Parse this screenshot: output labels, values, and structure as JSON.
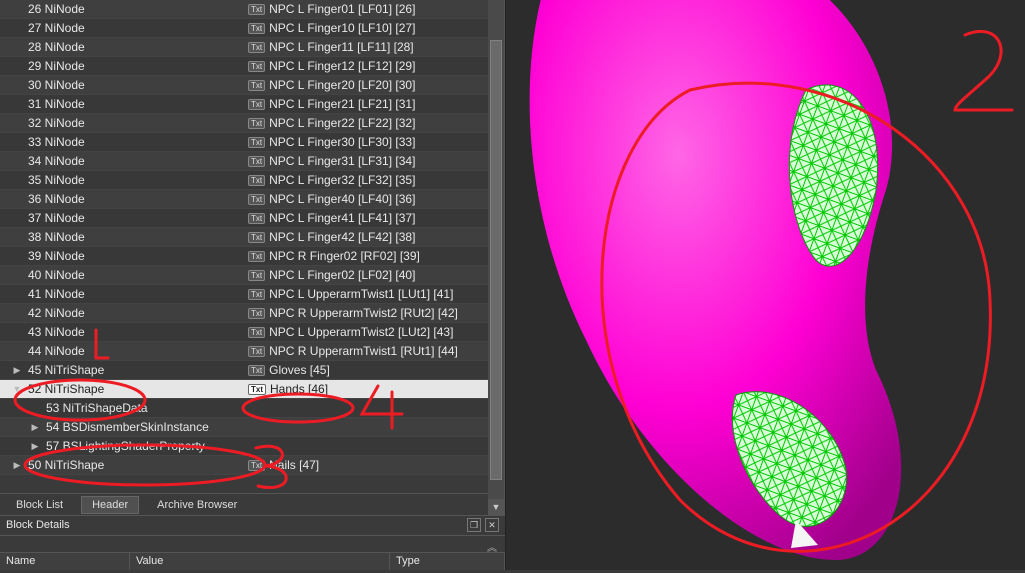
{
  "tree": [
    {
      "id": 26,
      "type": "NiNode",
      "value": "NPC L Finger01 [LF01] [26]",
      "indent": 0,
      "stripe": "even"
    },
    {
      "id": 27,
      "type": "NiNode",
      "value": "NPC L Finger10 [LF10] [27]",
      "indent": 0,
      "stripe": "odd"
    },
    {
      "id": 28,
      "type": "NiNode",
      "value": "NPC L Finger11 [LF11] [28]",
      "indent": 0,
      "stripe": "even"
    },
    {
      "id": 29,
      "type": "NiNode",
      "value": "NPC L Finger12 [LF12] [29]",
      "indent": 0,
      "stripe": "odd"
    },
    {
      "id": 30,
      "type": "NiNode",
      "value": "NPC L Finger20 [LF20] [30]",
      "indent": 0,
      "stripe": "even"
    },
    {
      "id": 31,
      "type": "NiNode",
      "value": "NPC L Finger21 [LF21] [31]",
      "indent": 0,
      "stripe": "odd"
    },
    {
      "id": 32,
      "type": "NiNode",
      "value": "NPC L Finger22 [LF22] [32]",
      "indent": 0,
      "stripe": "even"
    },
    {
      "id": 33,
      "type": "NiNode",
      "value": "NPC L Finger30 [LF30] [33]",
      "indent": 0,
      "stripe": "odd"
    },
    {
      "id": 34,
      "type": "NiNode",
      "value": "NPC L Finger31 [LF31] [34]",
      "indent": 0,
      "stripe": "even"
    },
    {
      "id": 35,
      "type": "NiNode",
      "value": "NPC L Finger32 [LF32] [35]",
      "indent": 0,
      "stripe": "odd"
    },
    {
      "id": 36,
      "type": "NiNode",
      "value": "NPC L Finger40 [LF40] [36]",
      "indent": 0,
      "stripe": "even"
    },
    {
      "id": 37,
      "type": "NiNode",
      "value": "NPC L Finger41 [LF41] [37]",
      "indent": 0,
      "stripe": "odd"
    },
    {
      "id": 38,
      "type": "NiNode",
      "value": "NPC L Finger42 [LF42] [38]",
      "indent": 0,
      "stripe": "even"
    },
    {
      "id": 39,
      "type": "NiNode",
      "value": "NPC R Finger02 [RF02] [39]",
      "indent": 0,
      "stripe": "odd"
    },
    {
      "id": 40,
      "type": "NiNode",
      "value": "NPC L Finger02 [LF02] [40]",
      "indent": 0,
      "stripe": "even"
    },
    {
      "id": 41,
      "type": "NiNode",
      "value": "NPC L UpperarmTwist1 [LUt1] [41]",
      "indent": 0,
      "stripe": "odd"
    },
    {
      "id": 42,
      "type": "NiNode",
      "value": "NPC R UpperarmTwist2 [RUt2] [42]",
      "indent": 0,
      "stripe": "even"
    },
    {
      "id": 43,
      "type": "NiNode",
      "value": "NPC L UpperarmTwist2 [LUt2] [43]",
      "indent": 0,
      "stripe": "odd"
    },
    {
      "id": 44,
      "type": "NiNode",
      "value": "NPC R UpperarmTwist1 [RUt1] [44]",
      "indent": 0,
      "stripe": "even"
    },
    {
      "id": 45,
      "type": "NiTriShape",
      "value": "Gloves [45]",
      "indent": 0,
      "stripe": "odd",
      "expando": "▶"
    },
    {
      "id": 52,
      "type": "NiTriShape",
      "value": "Hands [46]",
      "indent": 0,
      "stripe": "even",
      "expando": "▼",
      "selected": true
    },
    {
      "id": 53,
      "type": "NiTriShapeData",
      "value": "",
      "indent": 1,
      "stripe": "odd"
    },
    {
      "id": 54,
      "type": "BSDismemberSkinInstance",
      "value": "",
      "indent": 1,
      "stripe": "even",
      "expando": "▶"
    },
    {
      "id": 57,
      "type": "BSLightingShaderProperty",
      "value": "",
      "indent": 1,
      "stripe": "odd",
      "expando": "▶"
    },
    {
      "id": 50,
      "type": "NiTriShape",
      "value": "Nails [47]",
      "indent": 0,
      "stripe": "even",
      "expando": "▶"
    }
  ],
  "tabs": {
    "block_list": "Block List",
    "header": "Header",
    "archive_browser": "Archive Browser"
  },
  "block_details_label": "Block Details",
  "columns": {
    "name": "Name",
    "value": "Value",
    "type": "Type"
  },
  "badge_label": "Txt",
  "annotations": {
    "n2": "2",
    "n3": "3",
    "n4": "4"
  },
  "colors": {
    "marker": "#ed1c24",
    "mesh_body": "#ff00d4",
    "wire": "#00ff00"
  }
}
